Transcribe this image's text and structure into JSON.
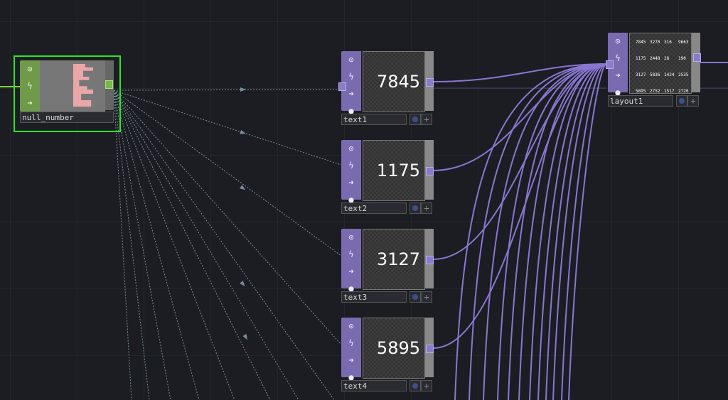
{
  "null_node": {
    "name": "null_number",
    "icons": [
      "gear-icon",
      "lightning-icon",
      "arrow-right-icon",
      "bomb-icon"
    ]
  },
  "text_nodes": [
    {
      "name": "text1",
      "value": "7845"
    },
    {
      "name": "text2",
      "value": "1175"
    },
    {
      "name": "text3",
      "value": "3127"
    },
    {
      "name": "text4",
      "value": "5895"
    }
  ],
  "layout_node": {
    "name": "layout1",
    "grid": [
      [
        "7845",
        "3270",
        "316",
        "9663"
      ],
      [
        "1175",
        "2448",
        "28",
        "190"
      ],
      [
        "3127",
        "5836",
        "1424",
        "2535"
      ],
      [
        "5895",
        "2752",
        "1517",
        "2720"
      ]
    ]
  },
  "colors": {
    "background": "#1b1d22",
    "top_operator": "#7a6ab0",
    "null_operator": "#6e9a4a",
    "selection": "#29e629",
    "wire_purple": "#8a76d0",
    "wire_dotted": "#7a8e9c"
  },
  "glyphs": {
    "gear": "⊙",
    "lightning": "ϟ",
    "arrow": "➜",
    "bomb": "●",
    "plus": "+"
  }
}
